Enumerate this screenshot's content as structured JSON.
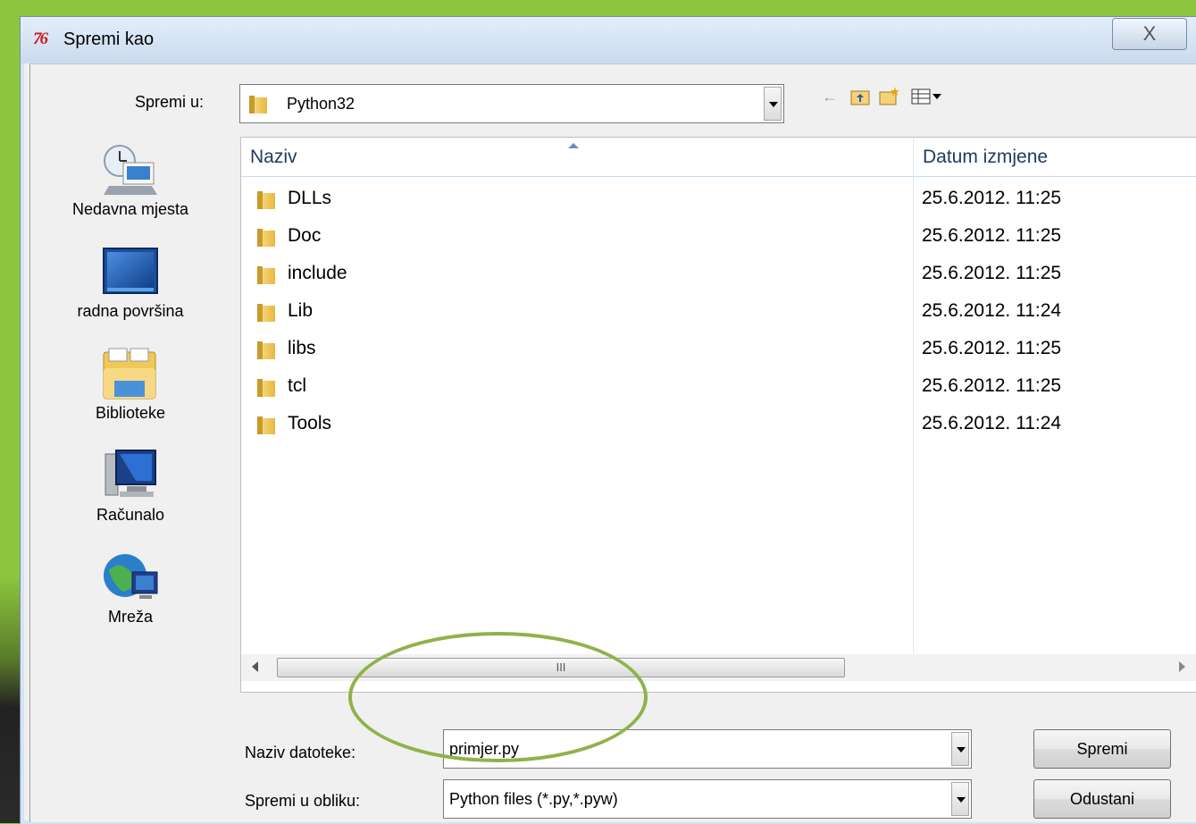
{
  "window": {
    "title": "Spremi kao",
    "app_icon_text": "76",
    "close_symbol": "X"
  },
  "save_in": {
    "label": "Spremi u:",
    "value": "Python32"
  },
  "toolbar": {
    "back_icon": "←",
    "up_icon": "⇧",
    "new_folder_icon": "✱",
    "view_icon": "▤"
  },
  "places": [
    {
      "label": "Nedavna mjesta",
      "icon": "recent-places-icon"
    },
    {
      "label": "radna površina",
      "icon": "desktop-icon"
    },
    {
      "label": "Biblioteke",
      "icon": "libraries-icon"
    },
    {
      "label": "Računalo",
      "icon": "computer-icon"
    },
    {
      "label": "Mreža",
      "icon": "network-icon"
    }
  ],
  "file_list": {
    "columns": {
      "name": "Naziv",
      "date": "Datum izmjene"
    },
    "rows": [
      {
        "name": "DLLs",
        "date": "25.6.2012. 11:25"
      },
      {
        "name": "Doc",
        "date": "25.6.2012. 11:25"
      },
      {
        "name": "include",
        "date": "25.6.2012. 11:25"
      },
      {
        "name": "Lib",
        "date": "25.6.2012. 11:24"
      },
      {
        "name": "libs",
        "date": "25.6.2012. 11:25"
      },
      {
        "name": "tcl",
        "date": "25.6.2012. 11:25"
      },
      {
        "name": "Tools",
        "date": "25.6.2012. 11:24"
      }
    ],
    "scroll_grip": "III"
  },
  "filename": {
    "label": "Naziv datoteke:",
    "value": "primjer.py"
  },
  "filetype": {
    "label": "Spremi u obliku:",
    "value": "Python files (*.py,*.pyw)"
  },
  "buttons": {
    "save": "Spremi",
    "cancel": "Odustani"
  },
  "colors": {
    "background_green": "#8cc63e",
    "highlight_ellipse": "#8fb24a",
    "header_text": "#1e3a5f"
  }
}
